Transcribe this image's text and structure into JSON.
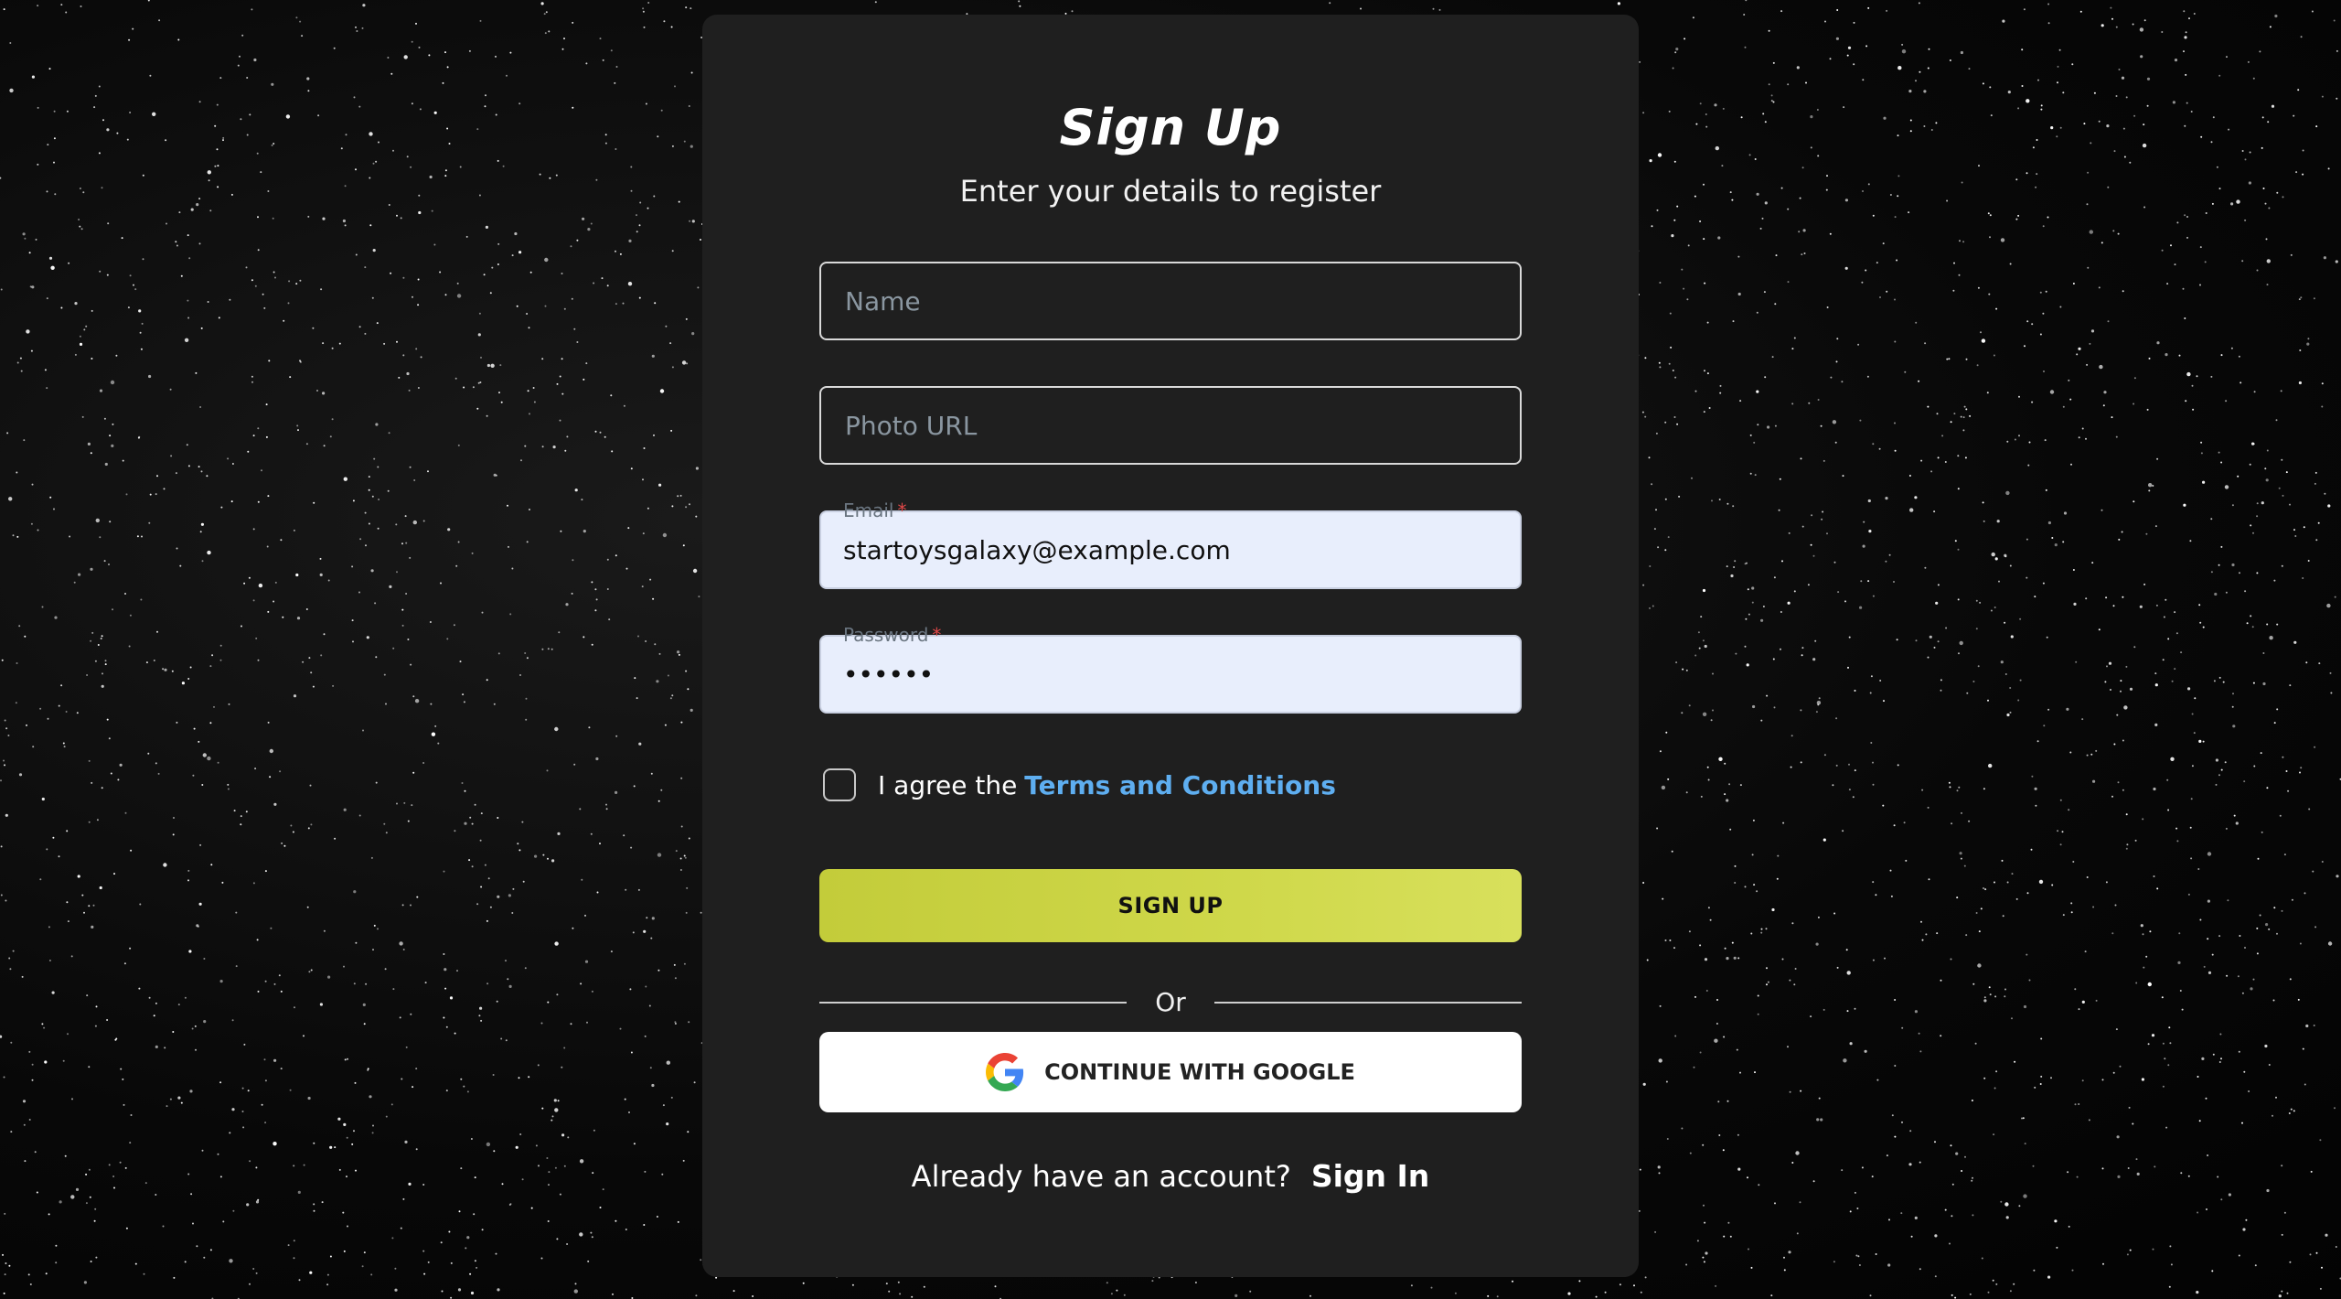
{
  "form": {
    "title": "Sign Up",
    "subtitle": "Enter your details to register",
    "name_placeholder": "Name",
    "photo_placeholder": "Photo URL",
    "email_label": "Email",
    "email_value": "startoysgalaxy@example.com",
    "password_label": "Password",
    "password_value": "••••••",
    "required_mark": "*",
    "terms_prefix": "I agree the",
    "terms_link": "Terms and Conditions",
    "terms_checked": false,
    "signup_label": "SIGN UP",
    "divider_text": "Or",
    "google_label": "CONTINUE WITH GOOGLE",
    "signin_prompt": "Already have an account?",
    "signin_link": "Sign In"
  },
  "icons": {
    "google": "google-g-logo"
  },
  "colors": {
    "card_bg": "#1f1f1f",
    "accent": "#cfd84a",
    "link": "#5eaef0",
    "filled_field_bg": "#e8eefc"
  }
}
